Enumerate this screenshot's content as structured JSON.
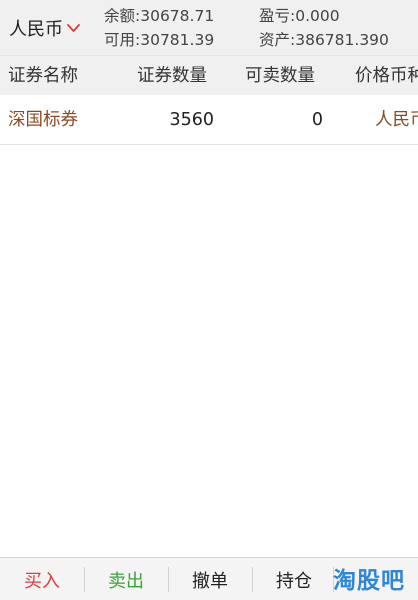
{
  "account": {
    "currency": "人民币",
    "balance": "余额:30678.71",
    "profit_loss": "盈亏:0.000",
    "available": "可用:30781.39",
    "assets": "资产:386781.390"
  },
  "table": {
    "headers": [
      "证券名称",
      "证券数量",
      "可卖数量",
      "价格币种"
    ],
    "rows": [
      {
        "name": "深国标券",
        "quantity": "3560",
        "available": "0",
        "currency": "人民币"
      }
    ]
  },
  "tabbar": {
    "buy": "买入",
    "sell": "卖出",
    "cancel": "撤单",
    "position": "持仓"
  },
  "watermark": "淘股吧",
  "colors": {
    "buy": "#e23b3b",
    "sell": "#3aa33a",
    "accent_chevron": "#d93a3a",
    "row_text": "#8a4a22",
    "watermark": "#2f86d6"
  }
}
